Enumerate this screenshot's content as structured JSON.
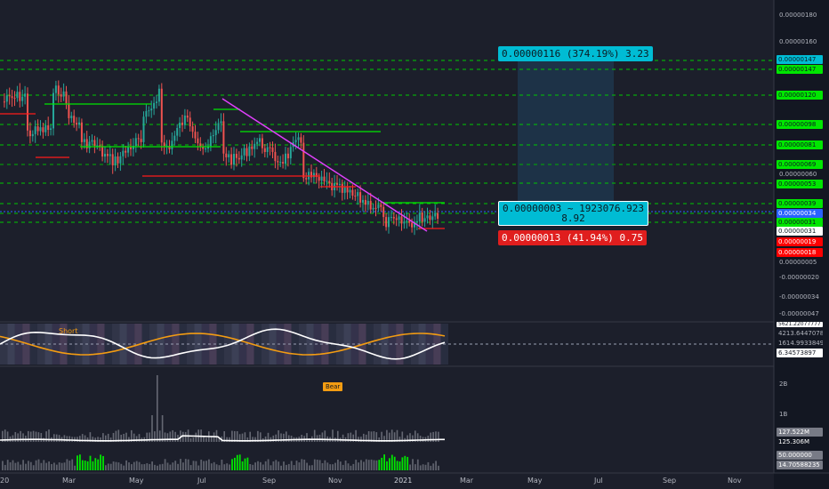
{
  "chart_data": {
    "type": "candlestick",
    "price_axis_ticks": [
      "0.00000180",
      "0.00000160",
      "0.00000120",
      "0.00000098",
      "0.00000081",
      "0.00000069",
      "0.00000060",
      "0.00000053",
      "0.00000039",
      "0.00000031",
      "0.00000018",
      "0.00000005",
      "-0.00000020",
      "-0.00000034",
      "-0.00000047"
    ],
    "level_tags": [
      {
        "text": "0.00000147",
        "bg": "#00bcd4",
        "fg": "#0b1a22",
        "y": 0.000147
      },
      {
        "text": "0.00000147",
        "bg": "#00e600",
        "fg": "#0b1a22",
        "y": 0.000143
      },
      {
        "text": "0.00000120",
        "bg": "#00e600",
        "fg": "#0b1a22",
        "y": 0.00012
      },
      {
        "text": "0.00000098",
        "bg": "#00e600",
        "fg": "#0b1a22",
        "y": 9.8e-05
      },
      {
        "text": "0.00000081",
        "bg": "#00e600",
        "fg": "#0b1a22",
        "y": 8.1e-05
      },
      {
        "text": "0.00000069",
        "bg": "#00e600",
        "fg": "#0b1a22",
        "y": 6.9e-05
      },
      {
        "text": "0.00000053",
        "bg": "#00e600",
        "fg": "#0b1a22",
        "y": 5.3e-05
      },
      {
        "text": "0.00000039",
        "bg": "#00e600",
        "fg": "#0b1a22",
        "y": 3.9e-05
      },
      {
        "text": "0.00000034",
        "bg": "#2962ff",
        "fg": "#ffffff",
        "y": 3.4e-05
      },
      {
        "text": "0.00000031",
        "bg": "#00e600",
        "fg": "#0b1a22",
        "y": 3.1e-05
      },
      {
        "text": "0.00000031",
        "bg": "#ffffff",
        "fg": "#0b1a22",
        "y": 2.7e-05
      },
      {
        "text": "0.00000019",
        "bg": "#ff0000",
        "fg": "#ffffff",
        "y": 1.9e-05
      },
      {
        "text": "0.00000018",
        "bg": "#ff0000",
        "fg": "#ffffff",
        "y": 1.4e-05
      }
    ],
    "measure_boxes": [
      {
        "line1": "0.00000116 (374.19%) 3.23",
        "color": "#00bcd4",
        "fg": "#0b1a22"
      },
      {
        "line1": "0.00000003 ~ 1923076.923",
        "line2": "8.92",
        "color": "#00bcd4",
        "fg": "#0b1a22"
      },
      {
        "line1": "0.00000013 (41.94%) 0.75",
        "color": "#e01e1e",
        "fg": "#ffffff"
      }
    ],
    "time_axis": [
      "20",
      "Mar",
      "May",
      "Jul",
      "Sep",
      "Nov",
      "2021",
      "Mar",
      "May",
      "Jul",
      "Sep",
      "Nov"
    ],
    "oscillator": {
      "label": "Short",
      "ticks": [
        "4213.64470782",
        "1614.99338495",
        "6.34573897"
      ],
      "top_tick": "5621.22077777"
    },
    "volume_panel": {
      "label": "Bear",
      "ticks": [
        "2B",
        "1B"
      ],
      "tags": [
        {
          "text": "127.522M",
          "bg": "#787b86",
          "fg": "#ffffff"
        },
        {
          "text": "125.306M",
          "bg": "#131722",
          "fg": "#ffffff"
        },
        {
          "text": "50.000000",
          "bg": "#787b86",
          "fg": "#ffffff"
        },
        {
          "text": "14.70588235",
          "bg": "#787b86",
          "fg": "#ffffff"
        }
      ]
    },
    "colors": {
      "up": "#26a69a",
      "down": "#ef5350",
      "support": "#00e600",
      "resistance": "#ff1a1a",
      "trendline": "#e040fb",
      "grid_dash": "#00c800",
      "blue_dot": "#2962ff",
      "osc_white": "#ffffff",
      "osc_orange": "#f39c12"
    }
  }
}
